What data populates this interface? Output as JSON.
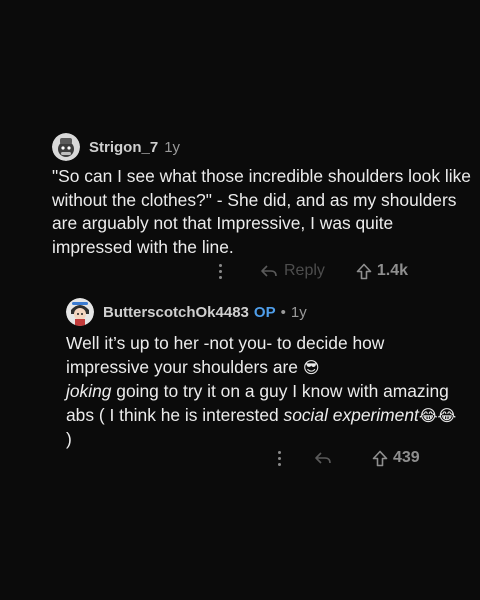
{
  "comment_1": {
    "username": "Strigon_7",
    "age": "1y",
    "body": "\"So can I see what those incredible shoulders look like without the clothes?\" - She did, and as my shoulders are arguably not that Impressive, I was quite impressed with the line.",
    "actions": {
      "reply_label": "Reply",
      "upvotes": "1.4k"
    }
  },
  "comment_2": {
    "username": "ButterscotchOk4483",
    "op_badge": "OP",
    "separator": "•",
    "age": "1y",
    "body": {
      "line1": "Well it’s up to her -not you- to decide how impressive your shoulders are ",
      "emoji1": "😎",
      "line2_italic": "joking",
      "line2": " going to try it on a guy I know with amazing abs ( I think he is interested ",
      "italic2": "social experiment",
      "emoji2": "😂😂",
      "line3": " )"
    },
    "actions": {
      "upvotes": "439"
    }
  },
  "icons": {
    "more": "more-vertical-icon",
    "reply": "reply-arrow-icon",
    "upvote": "upvote-arrow-icon"
  }
}
